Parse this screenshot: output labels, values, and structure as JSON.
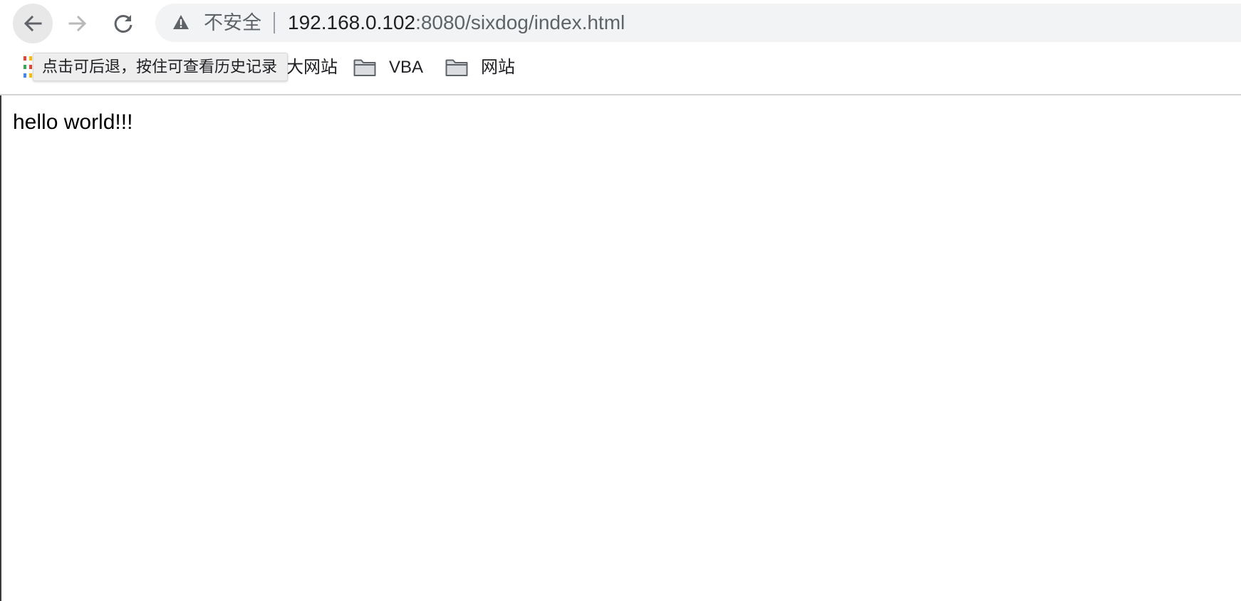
{
  "toolbar": {
    "back_icon": "arrow-left-icon",
    "forward_icon": "arrow-right-icon",
    "reload_icon": "reload-icon",
    "omnibox": {
      "security_icon": "warning-triangle-icon",
      "security_label": "不安全",
      "url_host": "192.168.0.102",
      "url_path": ":8080/sixdog/index.html"
    }
  },
  "bookmarks": {
    "apps_icon": "apps-grid-icon",
    "items": [
      {
        "label": "网站",
        "icon": "",
        "partial_prefix": "大"
      },
      {
        "label": "VBA",
        "icon": "folder-icon"
      },
      {
        "label": "网站",
        "icon": "folder-icon"
      }
    ]
  },
  "tooltip": {
    "text": "点击可后退，按住可查看历史记录"
  },
  "page": {
    "body_text": "hello world!!!"
  },
  "colors": {
    "omnibox_bg": "#f1f3f4",
    "back_button_hover_bg": "#e8e8e9",
    "url_host": "#202124",
    "url_path": "#5f6368",
    "tooltip_bg": "#eeeeee"
  }
}
